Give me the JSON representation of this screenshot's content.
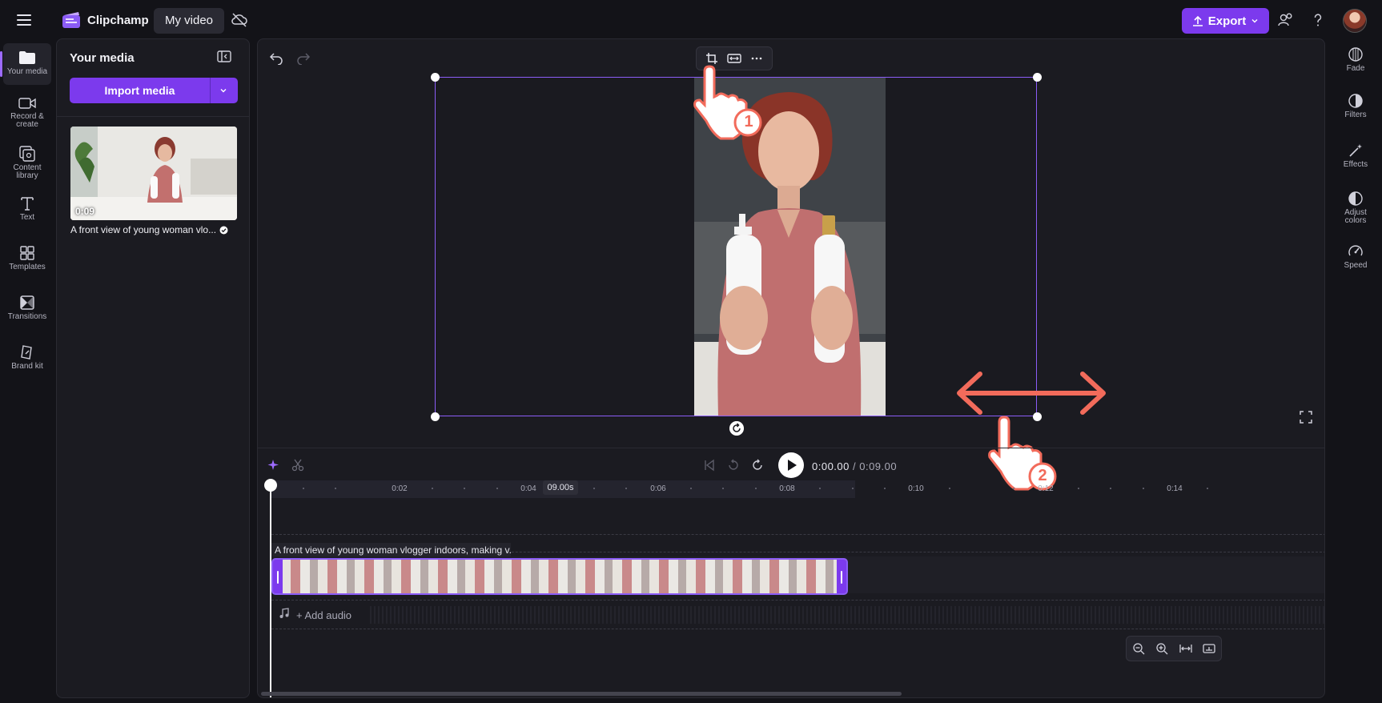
{
  "header": {
    "brand": "Clipchamp",
    "project_name": "My video",
    "export_label": "Export"
  },
  "left_nav": {
    "items": [
      {
        "label": "Your media",
        "icon": "folder-icon"
      },
      {
        "label": "Record &\ncreate",
        "icon": "camera-icon"
      },
      {
        "label": "Content\nlibrary",
        "icon": "library-icon"
      },
      {
        "label": "Text",
        "icon": "text-icon"
      },
      {
        "label": "Templates",
        "icon": "templates-icon"
      },
      {
        "label": "Transitions",
        "icon": "transitions-icon"
      },
      {
        "label": "Brand kit",
        "icon": "brand-kit-icon"
      }
    ]
  },
  "media_panel": {
    "title": "Your media",
    "import_label": "Import media",
    "items": [
      {
        "duration": "0:09",
        "caption": "A front view of young woman vlo..."
      }
    ]
  },
  "timeline": {
    "current_time": "0:00.00",
    "total_time": "/ 0:09.00",
    "duration_badge": "09.00s",
    "ticks": [
      "0:02",
      "0:04",
      "0:06",
      "0:08",
      "0:10",
      "0:12",
      "0:14"
    ],
    "clip_label": "A front view of young woman vlogger indoors, making v...",
    "add_audio": "+ Add audio"
  },
  "annotations": {
    "step1": "1",
    "step2": "2"
  },
  "right_panel": {
    "items": [
      {
        "label": "Fade",
        "icon": "fade-icon"
      },
      {
        "label": "Filters",
        "icon": "filters-icon"
      },
      {
        "label": "Effects",
        "icon": "effects-icon"
      },
      {
        "label": "Adjust\ncolors",
        "icon": "adjust-colors-icon"
      },
      {
        "label": "Speed",
        "icon": "speed-icon"
      }
    ]
  },
  "colors": {
    "accent": "#7c3aed",
    "selection": "#8b5cf6",
    "annotation": "#f26b5b"
  }
}
